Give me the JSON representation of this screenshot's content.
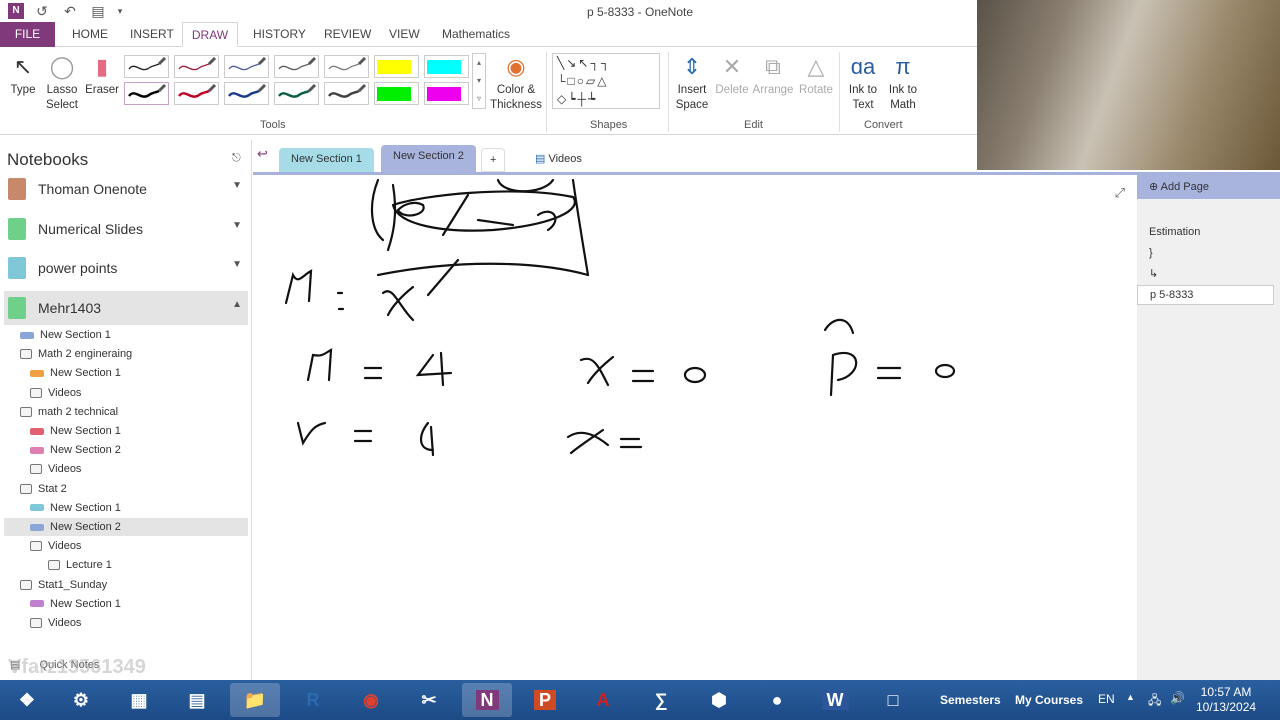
{
  "window": {
    "title": "p 5-8333 - OneNote"
  },
  "ribbon_tabs": [
    "FILE",
    "HOME",
    "INSERT",
    "DRAW",
    "HISTORY",
    "REVIEW",
    "VIEW",
    "Mathematics"
  ],
  "active_tab": "DRAW",
  "ribbon": {
    "type": "Type",
    "lasso": "Lasso\nSelect",
    "eraser": "Eraser",
    "tools_group": "Tools",
    "color_thickness": "Color &\nThickness",
    "shapes_group": "Shapes",
    "insert_space": "Insert\nSpace",
    "delete": "Delete",
    "arrange": "Arrange",
    "rotate": "Rotate",
    "edit_group": "Edit",
    "ink_to_text": "Ink to\nText",
    "ink_to_math": "Ink to\nMath",
    "convert_group": "Convert",
    "pens_row1": [
      "#222222",
      "#a02040",
      "#5060a0",
      "#606060",
      "#808080",
      "#ffff00",
      "#00ffff"
    ],
    "pens_row2": [
      "#000000",
      "#c00020",
      "#1a3a8a",
      "#0a6040",
      "#404040",
      "#00ee00",
      "#ee00ee"
    ]
  },
  "notebooks": {
    "header": "Notebooks",
    "items": [
      {
        "label": "Thoman Onenote",
        "color": "#c8896a"
      },
      {
        "label": "Numerical Slides",
        "color": "#6fd08a"
      },
      {
        "label": "power points",
        "color": "#7ec8d8"
      },
      {
        "label": "Mehr1403",
        "color": "#6fd08a"
      }
    ],
    "sections": [
      {
        "label": "New Section 1",
        "type": "section",
        "color": "#8aa6d8",
        "indent": 0
      },
      {
        "label": "Math 2 engineraing",
        "type": "group",
        "indent": 0
      },
      {
        "label": "New Section 1",
        "type": "section",
        "color": "#f0a040",
        "indent": 1
      },
      {
        "label": "Videos",
        "type": "group",
        "indent": 1
      },
      {
        "label": "math 2 technical",
        "type": "group",
        "indent": 0
      },
      {
        "label": "New Section 1",
        "type": "section",
        "color": "#e06070",
        "indent": 1
      },
      {
        "label": "New Section 2",
        "type": "section",
        "color": "#e080b0",
        "indent": 1
      },
      {
        "label": "Videos",
        "type": "group",
        "indent": 1
      },
      {
        "label": "Stat 2",
        "type": "group",
        "indent": 0
      },
      {
        "label": "New Section 1",
        "type": "section",
        "color": "#7ec8d8",
        "indent": 1
      },
      {
        "label": "New Section 2",
        "type": "section",
        "color": "#8aa6d8",
        "indent": 1,
        "selected": true
      },
      {
        "label": "Videos",
        "type": "group",
        "indent": 1
      },
      {
        "label": "Lecture 1",
        "type": "group",
        "indent": 2
      },
      {
        "label": "Stat1_Sunday",
        "type": "group",
        "indent": 0
      },
      {
        "label": "New Section 1",
        "type": "section",
        "color": "#c080d0",
        "indent": 1
      },
      {
        "label": "Videos",
        "type": "group",
        "indent": 1
      }
    ],
    "quick_notes": "Quick Notes",
    "watermark": "Vfarz13561349"
  },
  "section_tabs": [
    {
      "label": "New Section 1",
      "color": "#a6dce8"
    },
    {
      "label": "New Section 2",
      "color": "#a8b4de",
      "active": true
    },
    {
      "label": "+",
      "color": "#ffffff"
    },
    {
      "label": "Videos",
      "color": "#ffffff"
    }
  ],
  "pages": {
    "add_page": "Add Page",
    "items": [
      "Estimation",
      "}",
      "\u0013"
    ],
    "current": "p 5-8333"
  },
  "taskbar": {
    "apps": [
      "start",
      "hp",
      "calculator",
      "notepad",
      "explorer",
      "R",
      "chrome",
      "snipping",
      "onenote",
      "powerpoint",
      "acrobat",
      "math-input",
      "geogebra",
      "obs",
      "word",
      "file"
    ],
    "toolbars": [
      "Semesters",
      "My Courses"
    ],
    "lang": "EN",
    "time": "10:57 AM",
    "date": "10/13/2024"
  }
}
